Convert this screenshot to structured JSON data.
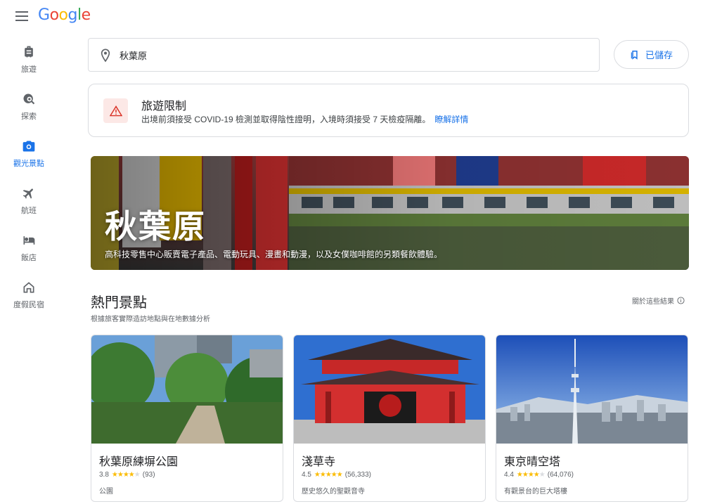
{
  "header": {
    "logo_parts": [
      "G",
      "o",
      "o",
      "g",
      "l",
      "e"
    ]
  },
  "sidebar": {
    "items": [
      {
        "label": "旅遊",
        "icon": "luggage-icon",
        "active": false
      },
      {
        "label": "探索",
        "icon": "explore-icon",
        "active": false
      },
      {
        "label": "觀光景點",
        "icon": "camera-icon",
        "active": true
      },
      {
        "label": "航班",
        "icon": "flight-icon",
        "active": false
      },
      {
        "label": "飯店",
        "icon": "hotel-bed-icon",
        "active": false
      },
      {
        "label": "度假民宿",
        "icon": "home-icon",
        "active": false
      }
    ]
  },
  "search": {
    "value": "秋葉原",
    "icon": "location-pin-icon"
  },
  "saved_button": {
    "label": "已儲存",
    "icon": "bookmark-icon"
  },
  "alert": {
    "title": "旅遊限制",
    "body": "出境前須接受 COVID-19 檢測並取得陰性證明，入境時須接受 7 天檢疫隔離。",
    "link": "瞭解詳情",
    "icon": "warning-icon",
    "color": "#d93025"
  },
  "hero": {
    "title": "秋葉原",
    "description": "高科技零售中心販賣電子產品、電動玩具、漫畫和動漫，以及女僕咖啡館的另類餐飲體驗。"
  },
  "section": {
    "title": "熱門景點",
    "subtitle": "根據旅客實際造訪地點與在地數據分析",
    "about_link": "關於這些結果"
  },
  "cards": [
    {
      "name": "秋葉原練塀公園",
      "rating": "3.8",
      "stars": 3.8,
      "reviews": "(93)",
      "category": "公園"
    },
    {
      "name": "淺草寺",
      "rating": "4.5",
      "stars": 4.5,
      "reviews": "(56,333)",
      "category": "歷史悠久的聖觀音寺"
    },
    {
      "name": "東京晴空塔",
      "rating": "4.4",
      "stars": 4.4,
      "reviews": "(64,076)",
      "category": "有觀景台的巨大塔樓"
    }
  ],
  "colors": {
    "accent": "#1a73e8",
    "star": "#fbbc04"
  }
}
